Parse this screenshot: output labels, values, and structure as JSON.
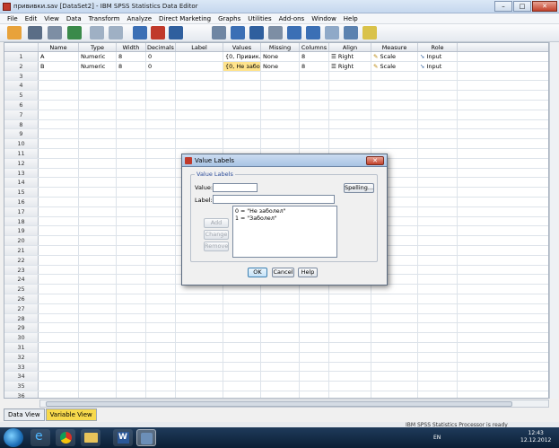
{
  "window": {
    "title": "прививки.sav [DataSet2] - IBM SPSS Statistics Data Editor",
    "controls": [
      "–",
      "□",
      "✕"
    ]
  },
  "menu": [
    "File",
    "Edit",
    "View",
    "Data",
    "Transform",
    "Analyze",
    "Direct Marketing",
    "Graphs",
    "Utilities",
    "Add-ons",
    "Window",
    "Help"
  ],
  "columns": [
    "Name",
    "Type",
    "Width",
    "Decimals",
    "Label",
    "Values",
    "Missing",
    "Columns",
    "Align",
    "Measure",
    "Role"
  ],
  "rows": [
    {
      "n": "1",
      "name": "A",
      "type": "Numeric",
      "width": "8",
      "decimals": "0",
      "label": "",
      "values": "{0, Привик...",
      "missing": "None",
      "columns": "8",
      "align": "Right",
      "measure": "Scale",
      "role": "Input"
    },
    {
      "n": "2",
      "name": "B",
      "type": "Numeric",
      "width": "8",
      "decimals": "0",
      "label": "",
      "values": "{0, Не забо...",
      "missing": "None",
      "columns": "8",
      "align": "Right",
      "measure": "Scale",
      "role": "Input"
    }
  ],
  "empty_row_numbers": [
    "3",
    "4",
    "5",
    "6",
    "7",
    "8",
    "9",
    "10",
    "11",
    "12",
    "13",
    "14",
    "15",
    "16",
    "17",
    "18",
    "19",
    "20",
    "21",
    "22",
    "23",
    "24",
    "25",
    "26",
    "27",
    "28",
    "29",
    "30",
    "31",
    "32",
    "33",
    "34",
    "35",
    "36"
  ],
  "tabs": {
    "data_view": "Data View",
    "variable_view": "Variable View"
  },
  "status": "IBM SPSS Statistics Processor is ready",
  "dialog": {
    "title": "Value Labels",
    "group_label": "Value Labels",
    "value_label": "Value:",
    "label_label": "Label:",
    "value_input": "",
    "label_input": "",
    "spelling": "Spelling...",
    "add": "Add",
    "change": "Change",
    "remove": "Remove",
    "list": [
      "0 = \"Не заболел\"",
      "1 = \"Заболел\""
    ],
    "ok": "OK",
    "cancel": "Cancel",
    "help": "Help"
  },
  "taskbar": {
    "lang": "EN",
    "time": "12:43",
    "date": "12.12.2012"
  }
}
